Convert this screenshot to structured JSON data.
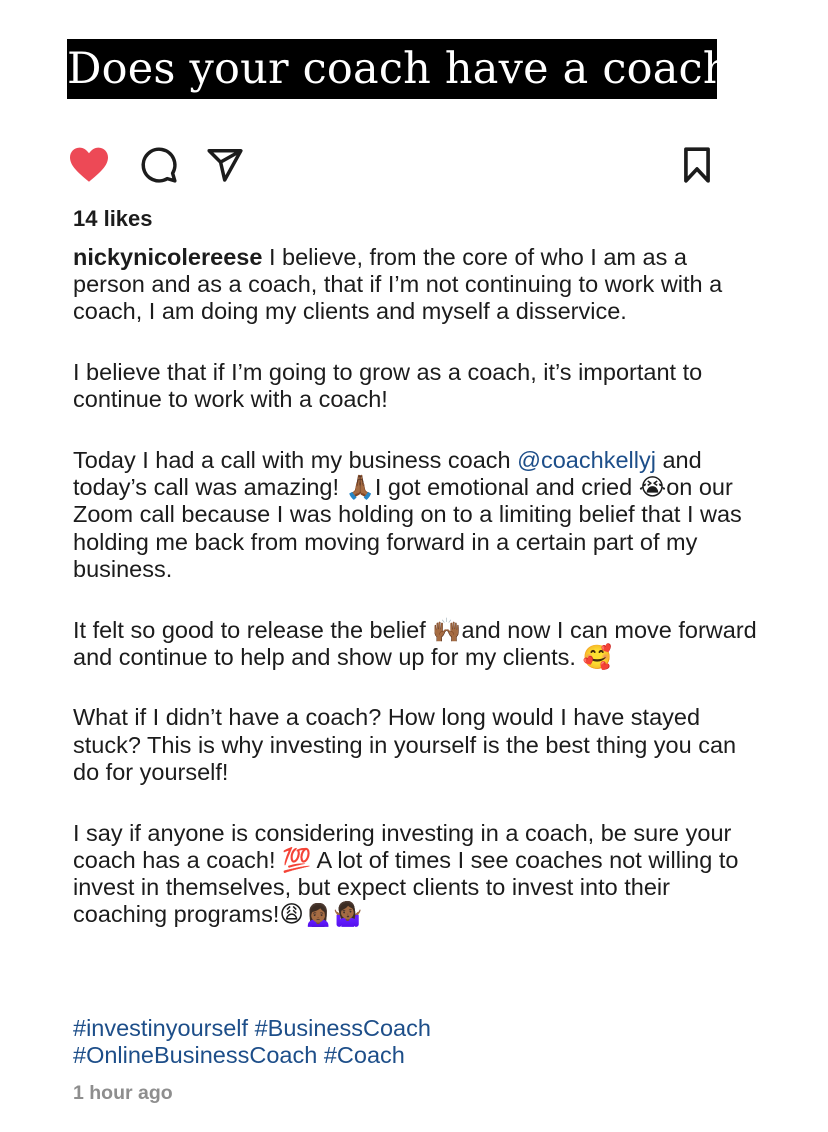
{
  "banner": {
    "title": "Does your coach have a coach?"
  },
  "actions": {
    "like_icon": "heart-icon",
    "comment_icon": "comment-icon",
    "share_icon": "send-icon",
    "save_icon": "bookmark-icon",
    "like_color": "#ed4956"
  },
  "post": {
    "likes": "14 likes",
    "username": "nickynicolereese",
    "paragraphs": {
      "p1": " I believe, from the core of who I am as a person and as a coach, that if I’m not continuing to work with a coach, I am doing my clients and myself a disservice.",
      "p2": "I believe that if I’m going to grow as a coach, it’s important to continue to work with a coach!",
      "p3_before": "Today I had a call with my business coach ",
      "p3_mention": "@coachkellyj",
      "p3_middle": " and today’s call was amazing! ",
      "p3_emoji1": "🙏🏾",
      "p3_after1": "I got emotional and cried ",
      "p3_emoji2": "😭",
      "p3_after2": "on our Zoom call because I was holding on to a limiting belief that I was holding me back from moving forward in a certain part of my business.",
      "p4_before": "It felt so good to release the belief ",
      "p4_emoji1": "🙌🏾",
      "p4_after": "and now I can move forward and continue to help and show up for my clients. ",
      "p4_emoji2": "🥰",
      "p5": "What if I didn’t have a coach? How long would I have stayed stuck? This is why investing in yourself is the best thing you can do for yourself!",
      "p6_before": "I say if anyone is considering investing in a coach, be sure your coach has a coach! ",
      "p6_emoji1": "💯",
      "p6_after": " A lot of times I see coaches not willing to invest in themselves, but expect clients to invest into their coaching programs!",
      "p6_emoji2": "😩🙍🏾‍♀️🤷🏾‍♀️"
    },
    "hashtags": [
      "#investinyourself",
      "#BusinessCoach",
      "#OnlineBusinessCoach",
      "#Coach"
    ],
    "timestamp": "1 hour ago"
  }
}
